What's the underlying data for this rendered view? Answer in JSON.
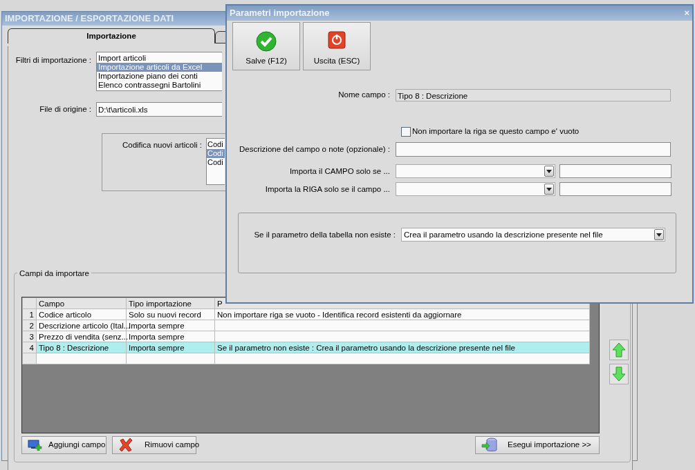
{
  "main_window": {
    "title": "IMPORTAZIONE / ESPORTAZIONE DATI",
    "tabs": [
      {
        "label": "Importazione",
        "selected": true
      },
      {
        "selected": false
      }
    ],
    "filters": {
      "label": "Filtri di importazione :",
      "items": [
        {
          "label": "Import articoli",
          "selected": false
        },
        {
          "label": "Importazione articoli da Excel",
          "selected": true
        },
        {
          "label": "Importazione piano dei conti",
          "selected": false
        },
        {
          "label": "Elenco contrassegni Bartolini",
          "selected": false
        }
      ]
    },
    "source_file": {
      "label": "File di origine :",
      "value": "D:\\t\\articoli.xls"
    },
    "coding": {
      "label": "Codifica nuovi articoli :",
      "items": [
        {
          "label": "Codi",
          "selected": false
        },
        {
          "label": "Codi",
          "selected": true
        },
        {
          "label": "Codi",
          "selected": false
        }
      ]
    },
    "fields_group": {
      "title": "Campi da importare",
      "table": {
        "columns": [
          "Campo",
          "Tipo importazione",
          "P"
        ],
        "rows": [
          {
            "number": "1",
            "cells": [
              "Codice articolo",
              "Solo su nuovi record",
              "Non importare riga se vuoto - Identifica record esistenti da aggiornare"
            ],
            "selected": false
          },
          {
            "number": "2",
            "cells": [
              "Descrizione articolo (Ital...",
              "Importa sempre",
              ""
            ],
            "selected": false
          },
          {
            "number": "3",
            "cells": [
              "Prezzo di vendita (senz...",
              "Importa sempre",
              ""
            ],
            "selected": false
          },
          {
            "number": "4",
            "cells": [
              "Tipo 8 : Descrizione",
              "Importa sempre",
              "Se il parametro non esiste : Crea il parametro usando la descrizione presente nel file"
            ],
            "selected": true
          }
        ]
      },
      "buttons": [
        {
          "label": "Aggiungi campo",
          "kind": "add"
        },
        {
          "label": "Rimuovi campo",
          "kind": "remove"
        },
        {
          "label": "Esegui importazione >>",
          "kind": "run"
        }
      ]
    }
  },
  "dialog": {
    "title": "Parametri importazione",
    "close": "×",
    "toolbar": [
      {
        "label": "Salve (F12)",
        "kind": "save"
      },
      {
        "label": "Uscita (ESC)",
        "kind": "exit"
      }
    ],
    "field_name": {
      "label": "Nome campo :",
      "value": "Tipo 8 : Descrizione"
    },
    "skip_empty": {
      "label": "Non importare la riga se questo campo e' vuoto",
      "checked": false
    },
    "description": {
      "label": "Descrizione del campo o note (opzionale) :"
    },
    "field_condition": {
      "label": "Importa il CAMPO solo se ..."
    },
    "row_condition": {
      "label": "Importa la RIGA solo se il campo ..."
    },
    "missing_param": {
      "label": "Se il parametro della tabella non esiste :",
      "value": "Crea il parametro usando la descrizione presente nel file"
    }
  }
}
